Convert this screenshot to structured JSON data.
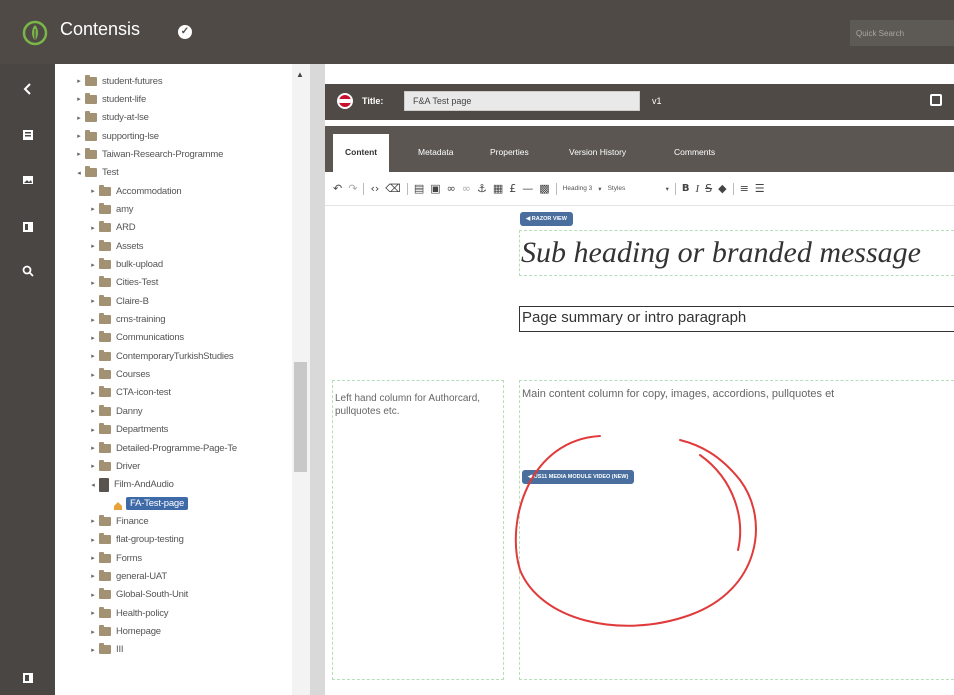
{
  "header": {
    "app_name": "Contensis",
    "search_placeholder": "Quick Search"
  },
  "rail": {
    "items": [
      "chevron-left-icon",
      "content-icon",
      "image-icon",
      "forms-icon",
      "search-icon",
      "settings-icon"
    ]
  },
  "tree": {
    "items": [
      {
        "label": "student-futures",
        "depth": 0,
        "caret": "▸"
      },
      {
        "label": "student-life",
        "depth": 0,
        "caret": "▸"
      },
      {
        "label": "study-at-lse",
        "depth": 0,
        "caret": "▸"
      },
      {
        "label": "supporting-lse",
        "depth": 0,
        "caret": "▸"
      },
      {
        "label": "Taiwan-Research-Programme",
        "depth": 0,
        "caret": "▸"
      },
      {
        "label": "Test",
        "depth": 0,
        "caret": "◂"
      },
      {
        "label": "Accommodation",
        "depth": 1,
        "caret": "▸"
      },
      {
        "label": "amy",
        "depth": 1,
        "caret": "▸"
      },
      {
        "label": "ARD",
        "depth": 1,
        "caret": "▸"
      },
      {
        "label": "Assets",
        "depth": 1,
        "caret": "▸"
      },
      {
        "label": "bulk-upload",
        "depth": 1,
        "caret": "▸"
      },
      {
        "label": "Cities-Test",
        "depth": 1,
        "caret": "▸"
      },
      {
        "label": "Claire-B",
        "depth": 1,
        "caret": "▸"
      },
      {
        "label": "cms-training",
        "depth": 1,
        "caret": "▸"
      },
      {
        "label": "Communications",
        "depth": 1,
        "caret": "▸"
      },
      {
        "label": "ContemporaryTurkishStudies",
        "depth": 1,
        "caret": "▸"
      },
      {
        "label": "Courses",
        "depth": 1,
        "caret": "▸"
      },
      {
        "label": "CTA-icon-test",
        "depth": 1,
        "caret": "▸"
      },
      {
        "label": "Danny",
        "depth": 1,
        "caret": "▸"
      },
      {
        "label": "Departments",
        "depth": 1,
        "caret": "▸"
      },
      {
        "label": "Detailed-Programme-Page-Te",
        "depth": 1,
        "caret": "▸"
      },
      {
        "label": "Driver",
        "depth": 1,
        "caret": "▸"
      },
      {
        "label": "Film-AndAudio",
        "depth": 1,
        "caret": "◂",
        "dark": true
      },
      {
        "label": "FA-Test-page",
        "depth": 2,
        "caret": "",
        "page": true,
        "selected": true
      },
      {
        "label": "Finance",
        "depth": 1,
        "caret": "▸"
      },
      {
        "label": "flat-group-testing",
        "depth": 1,
        "caret": "▸"
      },
      {
        "label": "Forms",
        "depth": 1,
        "caret": "▸"
      },
      {
        "label": "general-UAT",
        "depth": 1,
        "caret": "▸"
      },
      {
        "label": "Global-South-Unit",
        "depth": 1,
        "caret": "▸"
      },
      {
        "label": "Health-policy",
        "depth": 1,
        "caret": "▸"
      },
      {
        "label": "Homepage",
        "depth": 1,
        "caret": "▸"
      },
      {
        "label": "III",
        "depth": 1,
        "caret": "▸"
      }
    ]
  },
  "editor": {
    "title_label": "Title:",
    "title_value": "F&A Test page",
    "version": "v1",
    "tabs": [
      "Content",
      "Metadata",
      "Properties",
      "Version History",
      "Comments"
    ],
    "active_tab": "Content",
    "toolbar": {
      "format_select": "Heading 3",
      "styles_select": "Styles"
    },
    "razor_badge": "RAZOR VIEW",
    "subheading": "Sub heading or branded message",
    "summary": "Page summary or intro paragraph",
    "left_column_text": "Left hand column for Authorcard, pullquotes etc.",
    "main_column_text": "Main content column for copy, images, accordions, pullquotes et",
    "media_badge": "US11 MEDIA MODULE VIDEO (NEW)"
  },
  "colors": {
    "header_bg": "#4f4a46",
    "brand_green": "#7ab648",
    "badge_blue": "#4a6e9e",
    "annotation_red": "#e03a3a"
  }
}
